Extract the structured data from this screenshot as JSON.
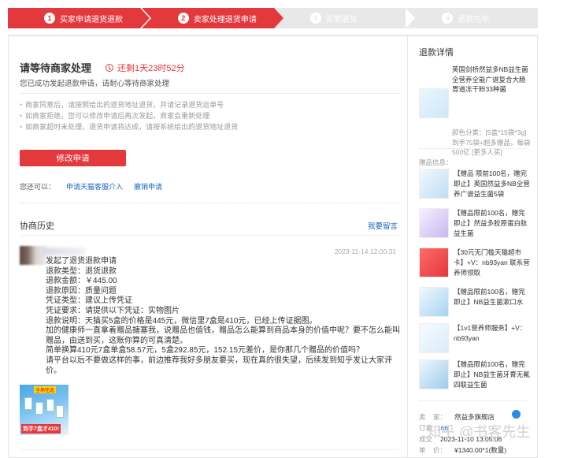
{
  "steps": [
    {
      "num": "1",
      "label": "买家申请退货退款",
      "active": true
    },
    {
      "num": "2",
      "label": "卖家处理退货申请",
      "active": true
    },
    {
      "num": "3",
      "label": "买家退货",
      "active": false
    },
    {
      "num": "4",
      "label": "退款完毕",
      "active": false
    }
  ],
  "status": {
    "title": "请等待商家处理",
    "timer": "还剩1天23时52分",
    "subtitle": "您已成功发起退款申请，请耐心等待商家处理"
  },
  "tips": [
    "商家同意后，请按照给出的退货地址退货，并请记录退货运单号",
    "如商家拒绝，您可以修改申请后再次发起，商家会重新处理",
    "如商家超时未处理，退货申请将达成，请按系统给出的退货地址退货"
  ],
  "actions": {
    "modify_button": "修改申请",
    "also_label": "您还可以：",
    "link_intervene": "申请天猫客服介入",
    "link_cancel": "撤销申请"
  },
  "history": {
    "title": "协商历史",
    "leave_message": "我要留言",
    "timestamp": "2023-11-14 12:00:31",
    "lines": [
      "发起了退货退款申请",
      "退款类型：退货退款",
      "退款金额：￥445.00",
      "退款原因：质量问题",
      "凭证类型：建议上传凭证",
      "凭证要求：请提供以下凭证：实物图片",
      "退款说明：天猫买5盒的价格是445元，微信里7盒是410元，已经上传证据图。",
      "加的健康师一直拿着赠品搪塞我，说赠品也值钱，赠品怎么能算到商品本身的价值中呢？要不怎么能叫赠品，由送到买，这账你算的可真清楚。",
      "简单换算410元7盒单盒58.57元，5盒292.85元，152.15元差价，是你那几个赠品的价值吗？",
      "请平台以后不要做这样的事，前边推荐我好多朋友要买，现在真的很失望，后续发到知乎发让大家评价。"
    ],
    "image_tag": "全场任选",
    "image_price": "到手7盒才410!"
  },
  "sidebar": {
    "title": "退款详情",
    "product_name": "英国剑桥然益多NB益生菌全营养全能广谱复合大肠胃道冻干粉33种菌",
    "product_spec": "颜色分类：[5盒*15袋*3g] 到手75袋+超多赠品，每袋500亿 [更多人买]",
    "gift_title": "赠品信息：",
    "gifts": [
      "【赠品 限前100名，赠完即止】英国然益多NB全营养广谱益生菌5袋",
      "【赠品限前100名，赠完即止】然益多胶原蛋白肽益生菌",
      "【30元无门槛天猫超市卡】+V：nb93yan 联系营养师领取",
      "【赠品限前100名，赠完即止】NB益生菌漱口水",
      "【1v1营养师服务】+V：nb93yan",
      "【赠品限前100名，赠完即止】NB益生菌牙膏无氟四联益生菌"
    ],
    "seller_label": "卖",
    "seller_label2": "家：",
    "seller_name": "然益多旗舰店",
    "order_label": "订单",
    "order_value": "166",
    "time_label": "成交",
    "time_value": "2023-11-10 13:05:06",
    "price_label": "单",
    "price_label2": "价：",
    "price_value": "¥1340.00*1(数量)"
  },
  "watermark": "知乎 @书客先生",
  "colors": {
    "accent": "#e4393c",
    "link": "#1a66c2"
  }
}
